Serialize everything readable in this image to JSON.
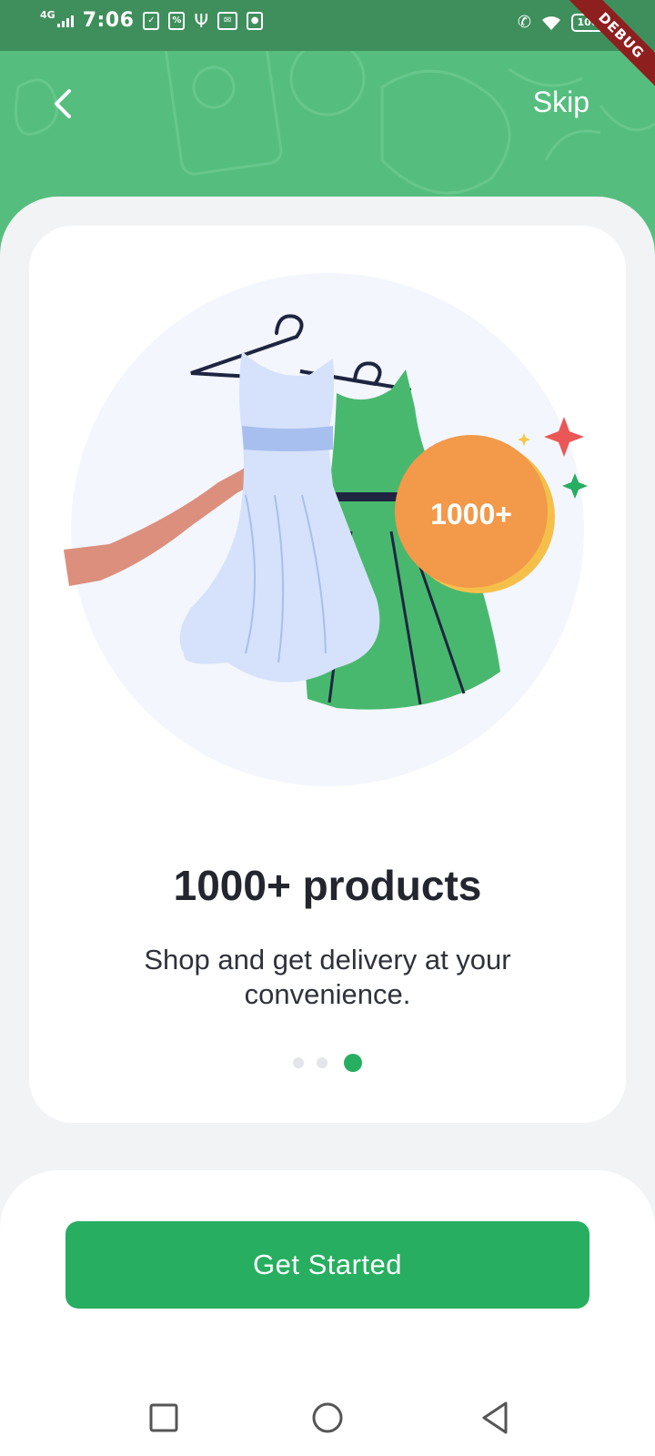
{
  "status_bar": {
    "network": "4G",
    "time": "7:06",
    "battery": "100",
    "debug_label": "DEBUG"
  },
  "header": {
    "skip_label": "Skip"
  },
  "onboarding": {
    "badge_text": "1000+",
    "title": "1000+ products",
    "subtitle": "Shop and get delivery at your convenience.",
    "pages": 3,
    "current_page": 3
  },
  "cta": {
    "label": "Get Started"
  },
  "colors": {
    "primary": "#27ae60",
    "header_green": "#55be7e",
    "badge_orange": "#f2994a"
  },
  "icons": {
    "back": "chevron-left-icon",
    "nav_recent": "square-icon",
    "nav_home": "circle-icon",
    "nav_back": "triangle-back-icon"
  }
}
